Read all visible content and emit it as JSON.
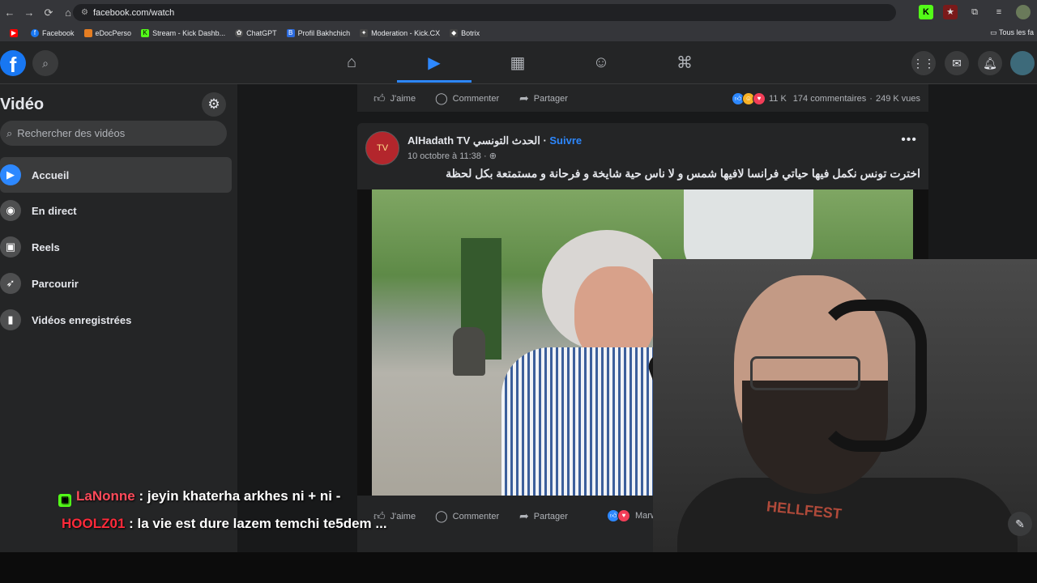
{
  "browser": {
    "url": "facebook.com/watch",
    "bookmarks": [
      "Facebook",
      "eDocPerso",
      "Stream - Kick Dashb...",
      "ChatGPT",
      "Profil Bakhchich",
      "Moderation - Kick.CX",
      "Botrix"
    ],
    "bookmarks_right": "Tous les fa"
  },
  "sidebar": {
    "title": "Vidéo",
    "search_placeholder": "Rechercher des vidéos",
    "items": [
      {
        "label": "Accueil",
        "icon": "play-icon"
      },
      {
        "label": "En direct",
        "icon": "live-icon"
      },
      {
        "label": "Reels",
        "icon": "reels-icon"
      },
      {
        "label": "Parcourir",
        "icon": "rocket-icon"
      },
      {
        "label": "Vidéos enregistrées",
        "icon": "bookmark-icon"
      }
    ]
  },
  "top_card": {
    "like": "J'aime",
    "comment": "Commenter",
    "share": "Partager",
    "reactions": "11 K",
    "comments_count": "174 commentaires",
    "views": "249 K vues"
  },
  "post": {
    "page_name": "AlHadath TV الحدث التونسي",
    "follow": "Suivre",
    "date": "10 octobre à 11:38",
    "caption": "اخترت تونس نكمل فيها حياتي فرانسا لافيها شمس و لا ناس حية شايخة و فرحانة و مستمتعة بكل لحظة",
    "like": "J'aime",
    "comment": "Commenter",
    "share": "Partager",
    "reactor": "Marwa Bous"
  },
  "chat": [
    {
      "user": "LaNonne",
      "message": ": jeyin khaterha arkhes ni + ni -"
    },
    {
      "user": "HOOLZ01",
      "message": ": la vie est dure lazem temchi te5dem ..."
    }
  ],
  "streamer_shirt": "HELLFEST"
}
